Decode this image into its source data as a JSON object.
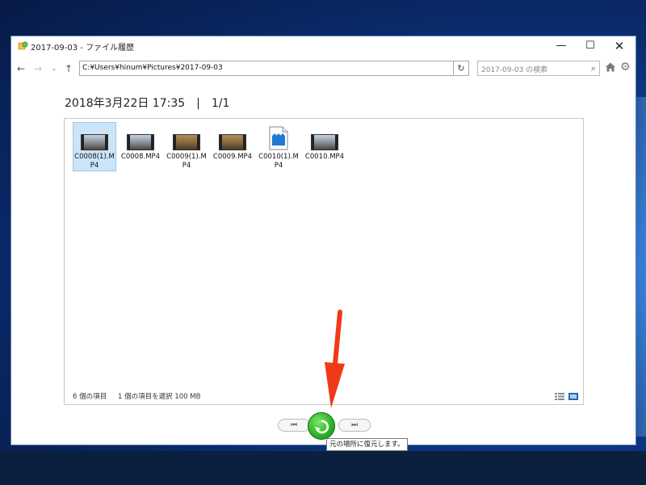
{
  "window": {
    "title": "2017-09-03 - ファイル履歴",
    "controls": {
      "minimize": "—",
      "maximize": "☐",
      "close": "✕"
    }
  },
  "navigation": {
    "back": "←",
    "forward": "→",
    "dropdown": "⌄",
    "up": "↑",
    "address": "C:¥Users¥hinum¥Pictures¥2017-09-03",
    "address_dropdown": "⌄",
    "refresh": "↻",
    "search_placeholder": "2017-09-03 の検索",
    "search_icon": "⌕",
    "settings": "⚙"
  },
  "heading": "2018年3月22日 17:35　|　1/1",
  "files": [
    {
      "name": "C0008(1).MP4",
      "icon": "video-thumbnail-icon",
      "selected": true
    },
    {
      "name": "C0008.MP4",
      "icon": "video-thumbnail-icon",
      "selected": false
    },
    {
      "name": "C0009(1).MP4",
      "icon": "video-thumbnail-icon",
      "selected": false
    },
    {
      "name": "C0009.MP4",
      "icon": "video-thumbnail-icon",
      "selected": false
    },
    {
      "name": "C0010(1).MP4",
      "icon": "video-file-icon",
      "selected": false
    },
    {
      "name": "C0010.MP4",
      "icon": "video-thumbnail-icon",
      "selected": false
    }
  ],
  "status": {
    "count": "6 個の項目",
    "selection": "1 個の項目を選択  100 MB"
  },
  "playback": {
    "previous": "⏮",
    "next": "⏭"
  },
  "tooltip": "元の場所に復元します。",
  "colors": {
    "restore_button": "#2fb52a",
    "selection_bg": "#cce4f7",
    "annotation_arrow": "#f03a17"
  }
}
